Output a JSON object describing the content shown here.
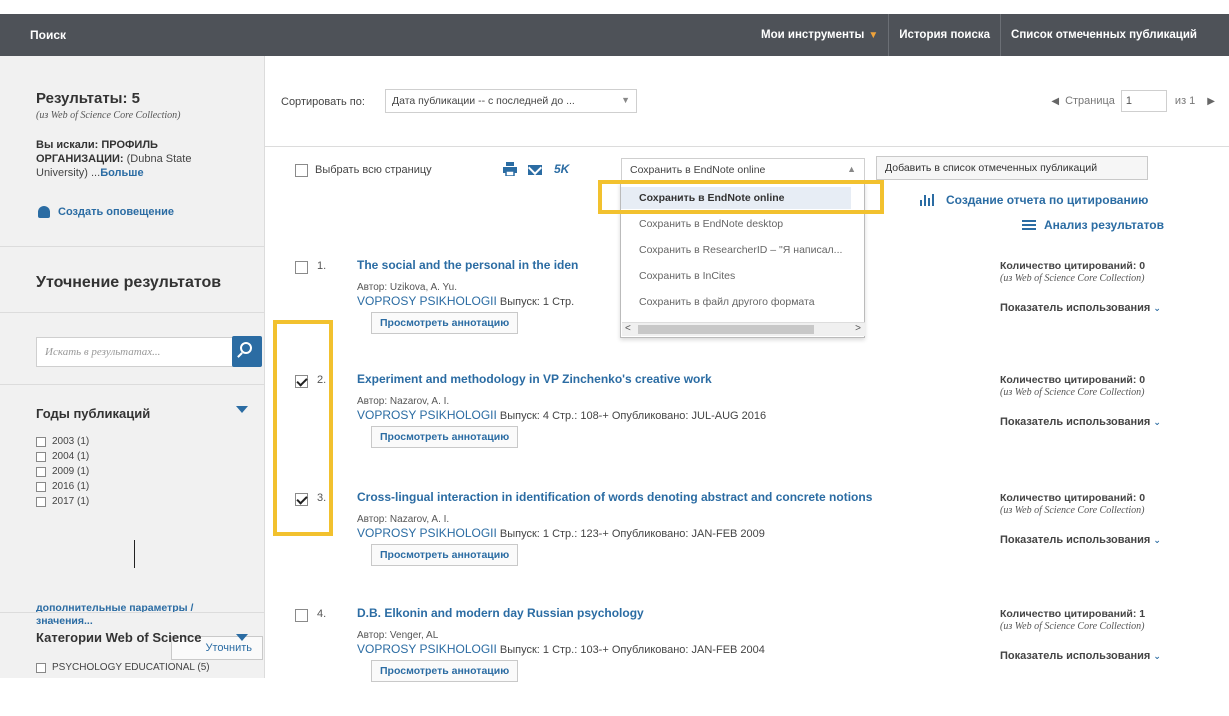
{
  "topbar": {
    "title": "Поиск",
    "nav": [
      {
        "label": "Мои инструменты",
        "has_caret": true
      },
      {
        "label": "История поиска"
      },
      {
        "label": "Список отмеченных публикаций"
      }
    ]
  },
  "sidebar": {
    "results_heading": "Результаты: 5",
    "results_source": "(из Web of Science Core Collection)",
    "searched_label": "Вы искали: ПРОФИЛЬ ОРГАНИЗАЦИИ:",
    "searched_value": "(Dubna State University) ...",
    "searched_more": "Больше",
    "alert_label": "Создать оповещение",
    "refine_heading": "Уточнение результатов",
    "search_placeholder": "Искать в результатах...",
    "pub_years_heading": "Годы публикаций",
    "pub_years": [
      "2003 (1)",
      "2004 (1)",
      "2009 (1)",
      "2016 (1)",
      "2017 (1)"
    ],
    "advanced_link": "дополнительные параметры / значения...",
    "refine_button": "Уточнить",
    "categories_heading": "Категории Web of Science",
    "categories": [
      "PSYCHOLOGY EDUCATIONAL (5)"
    ]
  },
  "main": {
    "sort_label": "Сортировать по:",
    "sort_value": "Дата публикации -- с последней до ...",
    "pager": {
      "label": "Страница",
      "current": "1",
      "of": "из 1"
    },
    "select_all_label": "Выбрать всю страницу",
    "count_label": "5K",
    "save_select_value": "Сохранить в EndNote online",
    "add_to_list_button": "Добавить в список отмеченных публикаций",
    "save_options": [
      "Сохранить в EndNote online",
      "Сохранить в EndNote desktop",
      "Сохранить в ResearcherID – \"Я написал...",
      "Сохранить в InCites",
      "Сохранить в файл другого формата"
    ],
    "citation_report_link": "Создание отчета по цитированию",
    "analyze_link": "Анализ результатов"
  },
  "results": [
    {
      "num": "1.",
      "title": "The social and the personal in the iden",
      "author": "Автор: Uzikova, A. Yu.",
      "journal": "VOPROSY PSIKHOLOGII",
      "details": "Выпуск: 1  Стр.",
      "checked": false,
      "citations": "Количество цитирований: 0",
      "cite_source": "(из Web of Science Core Collection)",
      "usage": "Показатель использования",
      "abstract_button": "Просмотреть аннотацию"
    },
    {
      "num": "2.",
      "title": "Experiment and methodology in VP Zinchenko's creative work",
      "author": "Автор: Nazarov, A. I.",
      "journal": "VOPROSY PSIKHOLOGII",
      "details": "Выпуск: 4   Стр.: 108-+   Опубликовано: JUL-AUG 2016",
      "checked": true,
      "citations": "Количество цитирований: 0",
      "cite_source": "(из Web of Science Core Collection)",
      "usage": "Показатель использования",
      "abstract_button": "Просмотреть аннотацию"
    },
    {
      "num": "3.",
      "title": "Cross-lingual interaction in identification of words denoting abstract and concrete notions",
      "author": "Автор: Nazarov, A. I.",
      "journal": "VOPROSY PSIKHOLOGII",
      "details": "Выпуск: 1   Стр.: 123-+   Опубликовано: JAN-FEB 2009",
      "checked": true,
      "citations": "Количество цитирований: 0",
      "cite_source": "(из Web of Science Core Collection)",
      "usage": "Показатель использования",
      "abstract_button": "Просмотреть аннотацию"
    },
    {
      "num": "4.",
      "title": "D.B. Elkonin and modern day Russian psychology",
      "author": "Автор: Venger, AL",
      "journal": "VOPROSY PSIKHOLOGII",
      "details": "Выпуск: 1   Стр.: 103-+   Опубликовано: JAN-FEB 2004",
      "checked": false,
      "citations": "Количество цитирований: 1",
      "cite_source": "(из Web of Science Core Collection)",
      "usage": "Показатель использования",
      "abstract_button": "Просмотреть аннотацию"
    }
  ],
  "colors": {
    "topbar": "#4e5258",
    "link": "#2b6ca3",
    "highlight": "#f2c12e",
    "accent_orange": "#f0a33a"
  }
}
